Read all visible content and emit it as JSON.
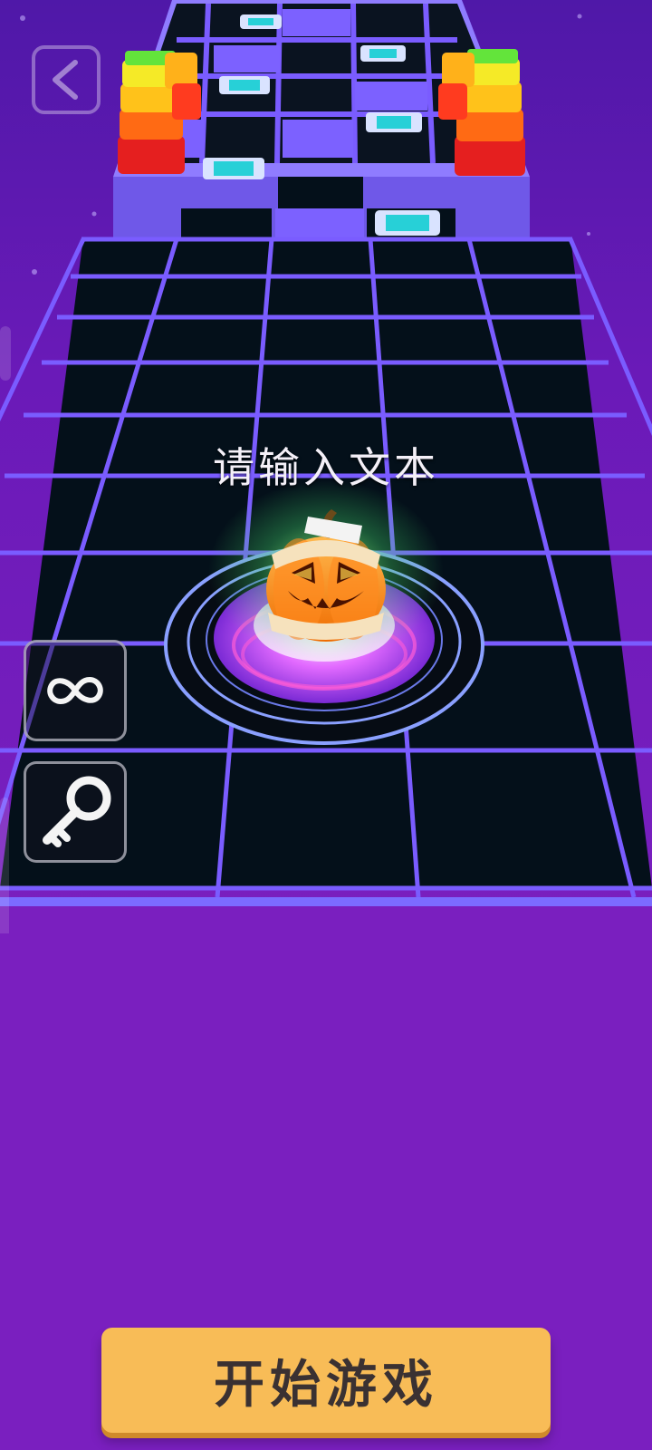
{
  "prompt": {
    "text": "请输入文本"
  },
  "controls": {
    "back": "back",
    "infinite": "infinite",
    "key": "key"
  },
  "start_button": {
    "label": "开始游戏"
  },
  "scene": {
    "character": "mummy-pumpkin",
    "colors": {
      "background": "#7a1fbf",
      "grid_line": "#7a5cff",
      "tile": "#06111b",
      "button": "#f8bc57"
    }
  }
}
